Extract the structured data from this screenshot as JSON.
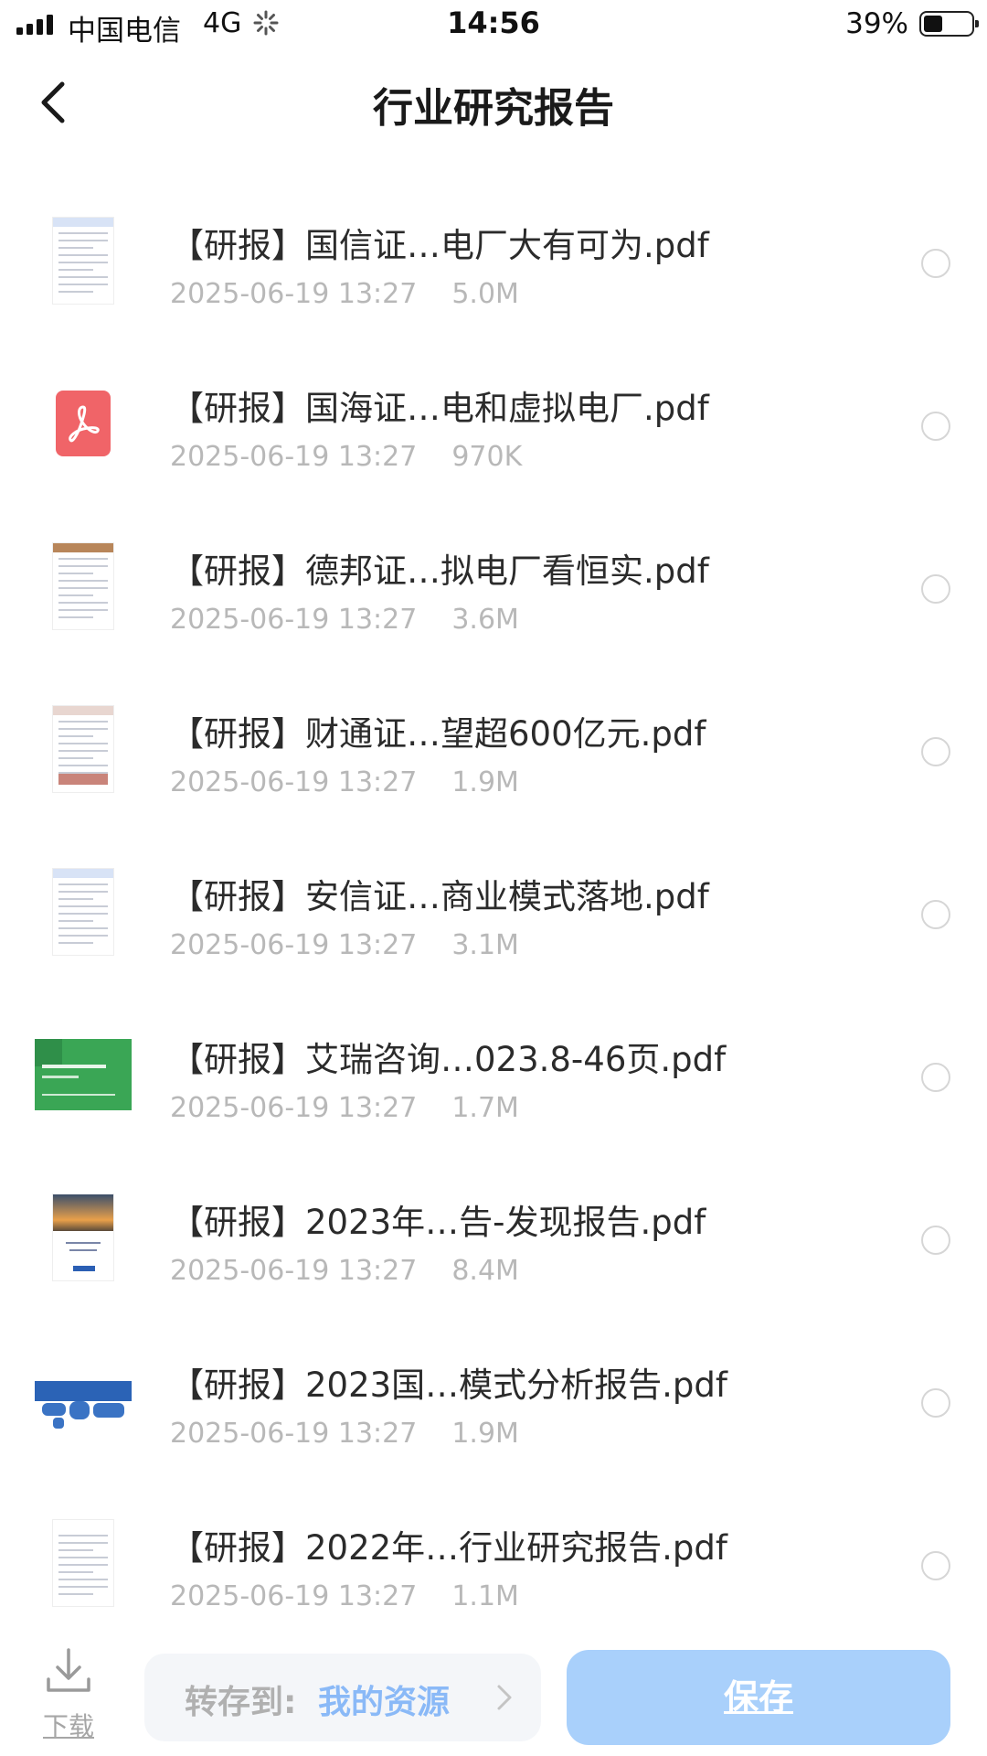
{
  "status_bar": {
    "carrier": "中国电信",
    "network": "4G",
    "time": "14:56",
    "battery_percent": "39%",
    "battery_level": 0.39
  },
  "nav": {
    "title": "行业研究报告",
    "back_icon": "chevron-left-icon"
  },
  "files": [
    {
      "name": "【研报】国信证…电厂大有可为.pdf",
      "date": "2025-06-19 13:27",
      "size": "5.0M",
      "thumb": "doc-blue",
      "selected": false
    },
    {
      "name": "【研报】国海证…电和虚拟电厂.pdf",
      "date": "2025-06-19 13:27",
      "size": "970K",
      "thumb": "pdf-icon",
      "selected": false
    },
    {
      "name": "【研报】德邦证…拟电厂看恒实.pdf",
      "date": "2025-06-19 13:27",
      "size": "3.6M",
      "thumb": "doc-brown",
      "selected": false
    },
    {
      "name": "【研报】财通证…望超600亿元.pdf",
      "date": "2025-06-19 13:27",
      "size": "1.9M",
      "thumb": "doc-red",
      "selected": false
    },
    {
      "name": "【研报】安信证…商业模式落地.pdf",
      "date": "2025-06-19 13:27",
      "size": "3.1M",
      "thumb": "doc-blue",
      "selected": false
    },
    {
      "name": "【研报】艾瑞咨询…023.8-46页.pdf",
      "date": "2025-06-19 13:27",
      "size": "1.7M",
      "thumb": "slide-green",
      "selected": false
    },
    {
      "name": "【研报】2023年…告-发现报告.pdf",
      "date": "2025-06-19 13:27",
      "size": "8.4M",
      "thumb": "doc-sunset",
      "selected": false
    },
    {
      "name": "【研报】2023国…模式分析报告.pdf",
      "date": "2025-06-19 13:27",
      "size": "1.9M",
      "thumb": "slide-map",
      "selected": false
    },
    {
      "name": "【研报】2022年…行业研究报告.pdf",
      "date": "2025-06-19 13:27",
      "size": "1.1M",
      "thumb": "doc-plain",
      "selected": false
    }
  ],
  "bottom_bar": {
    "download_label": "下载",
    "save_to_label": "转存到:",
    "save_to_target": "我的资源",
    "save_button": "保存"
  },
  "colors": {
    "accent": "#8ab9f7",
    "save_button_bg": "#a9d0fb",
    "pdf_icon": "#f06468",
    "meta_text": "#b8b8b8"
  }
}
